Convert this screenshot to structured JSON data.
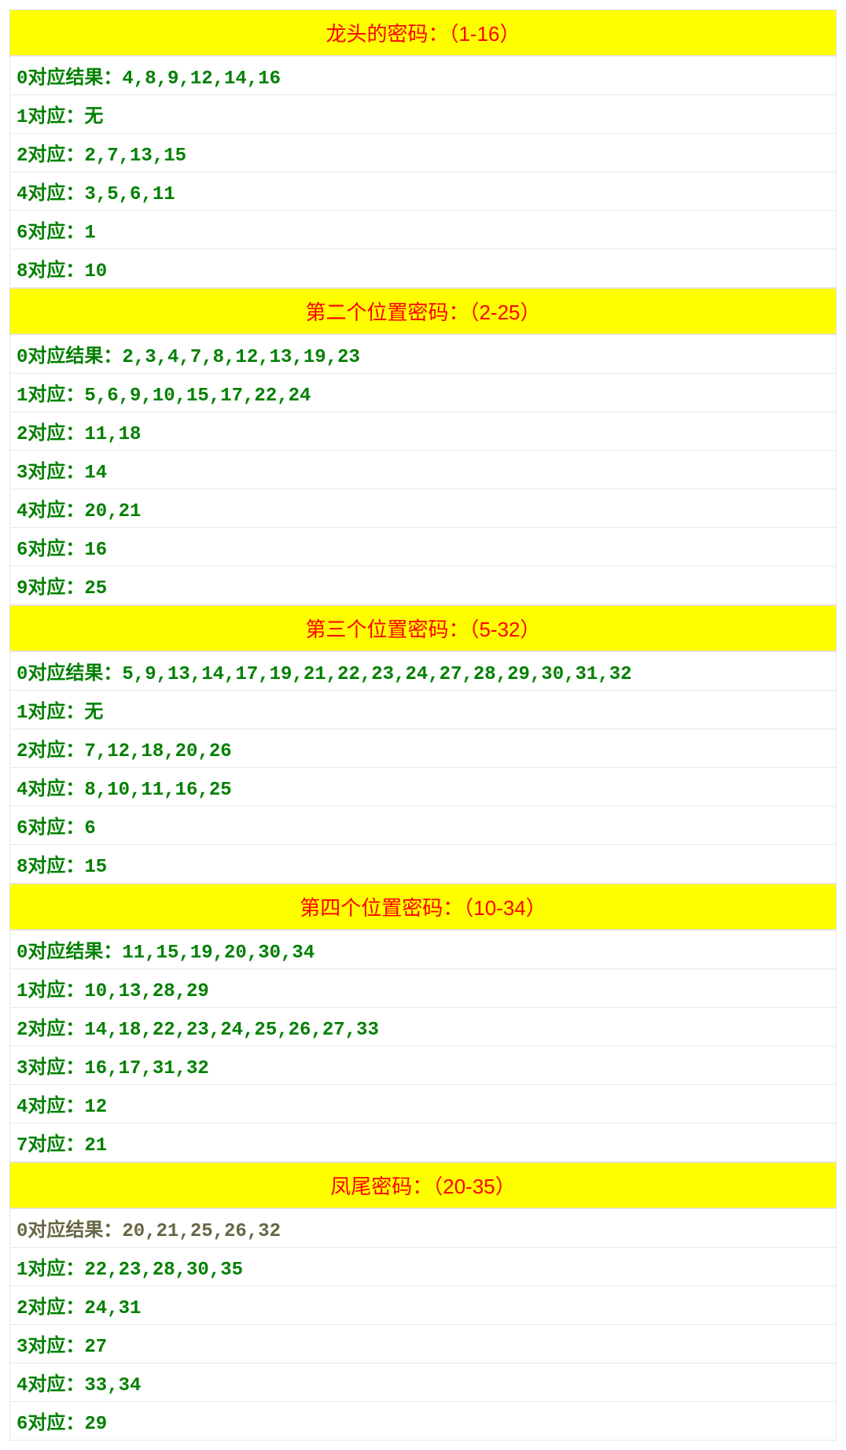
{
  "sections": [
    {
      "title": "龙头的密码：（1-16）",
      "rows": [
        "0对应结果：4,8,9,12,14,16",
        "1对应：无",
        "2对应：2,7,13,15",
        "4对应：3,5,6,11",
        "6对应：1",
        "8对应：10"
      ]
    },
    {
      "title": "第二个位置密码：（2-25）",
      "rows": [
        "0对应结果：2,3,4,7,8,12,13,19,23",
        "1对应：5,6,9,10,15,17,22,24",
        "2对应：11,18",
        "3对应：14",
        "4对应：20,21",
        "6对应：16",
        "9对应：25"
      ]
    },
    {
      "title": "第三个位置密码：（5-32）",
      "rows": [
        "0对应结果：5,9,13,14,17,19,21,22,23,24,27,28,29,30,31,32",
        "1对应：无",
        "2对应：7,12,18,20,26",
        "4对应：8,10,11,16,25",
        "6对应：6",
        "8对应：15"
      ]
    },
    {
      "title": "第四个位置密码：（10-34）",
      "rows": [
        "0对应结果：11,15,19,20,30,34",
        "1对应：10,13,28,29",
        "2对应：14,18,22,23,24,25,26,27,33",
        "3对应：16,17,31,32",
        "4对应：12",
        "7对应：21"
      ]
    },
    {
      "title": "凤尾密码：（20-35）",
      "rows": [
        "0对应结果：20,21,25,26,32",
        "1对应：22,23,28,30,35",
        "2对应：24,31",
        "3对应：27",
        "4对应：33,34",
        "6对应：29"
      ],
      "dimFirst": true
    }
  ]
}
